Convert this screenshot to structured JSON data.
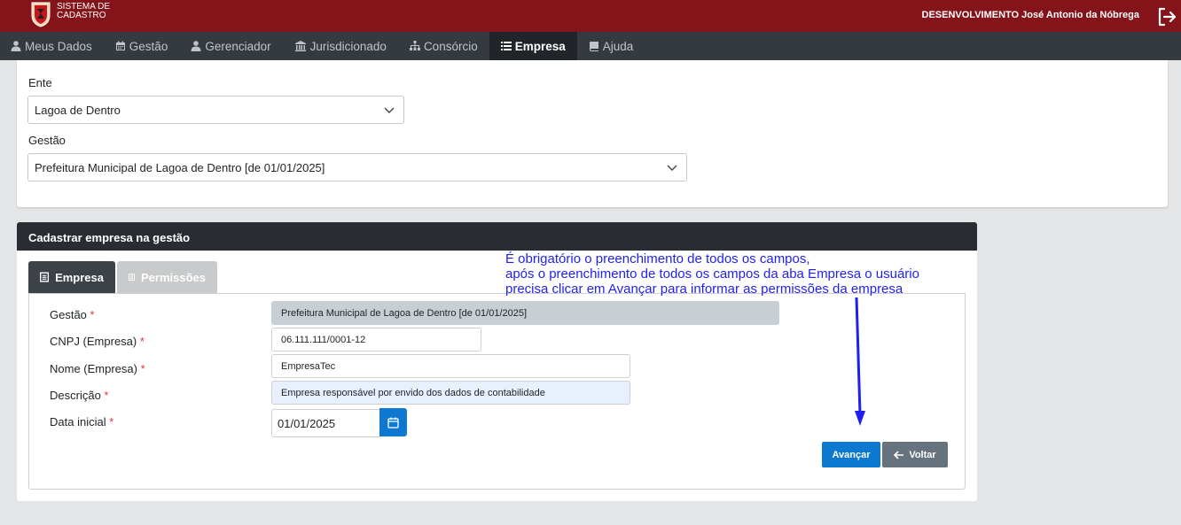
{
  "header": {
    "brand_line1": "SISTEMA DE",
    "brand_line2": "CADASTRO",
    "user": "DESENVOLVIMENTO José Antonio da Nóbrega",
    "logout_icon": "logout-icon"
  },
  "nav": {
    "items": [
      {
        "label": "Meus Dados",
        "icon": "user-icon"
      },
      {
        "label": "Gestão",
        "icon": "calendar-icon"
      },
      {
        "label": "Gerenciador",
        "icon": "user-icon"
      },
      {
        "label": "Jurisdicionado",
        "icon": "bank-icon"
      },
      {
        "label": "Consórcio",
        "icon": "sitemap-icon"
      },
      {
        "label": "Empresa",
        "icon": "list-icon",
        "active": true
      },
      {
        "label": "Ajuda",
        "icon": "book-icon"
      }
    ]
  },
  "filters": {
    "ente_label": "Ente",
    "ente_value": "Lagoa de Dentro",
    "gestao_label": "Gestão",
    "gestao_value": "Prefeitura Municipal de Lagoa de Dentro [de 01/01/2025]"
  },
  "form_card": {
    "title": "Cadastrar empresa na gestão",
    "tabs": [
      {
        "label": "Empresa",
        "active": true
      },
      {
        "label": "Permissões",
        "active": false
      }
    ],
    "fields": {
      "gestao_label": "Gestão",
      "gestao_value": "Prefeitura Municipal de Lagoa de Dentro [de 01/01/2025]",
      "cnpj_label": "CNPJ (Empresa)",
      "cnpj_value": "06.111.111/0001-12",
      "nome_label": "Nome (Empresa)",
      "nome_value": "EmpresaTec",
      "descricao_label": "Descrição",
      "descricao_value": "Empresa responsável por envido dos dados de contabilidade",
      "data_label": "Data inicial",
      "data_value": "01/01/2025",
      "required_mark": "*"
    },
    "buttons": {
      "next": "Avançar",
      "back": "Voltar"
    }
  },
  "annotation": {
    "line1": "É obrigatório o preenchimento de todos os campos,",
    "line2": "após o preenchimento de todos os campos da aba Empresa o usuário",
    "line3": "precisa clicar em Avançar para informar as permissões da empresa",
    "color": "#1f1ff2"
  },
  "colors": {
    "header": "#85131a",
    "nav": "#343a40",
    "primary": "#0d78d0",
    "secondary": "#66737f"
  }
}
